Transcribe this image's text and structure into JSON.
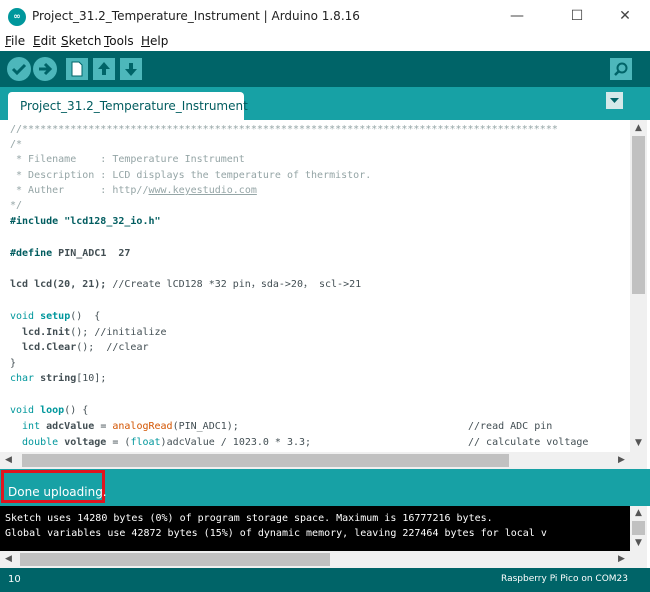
{
  "window": {
    "title": "Project_31.2_Temperature_Instrument | Arduino 1.8.16",
    "minimize": "—",
    "maximize": "☐",
    "close": "✕"
  },
  "menu": [
    {
      "prefix": "",
      "u": "F",
      "rest": "ile"
    },
    {
      "prefix": "",
      "u": "E",
      "rest": "dit"
    },
    {
      "prefix": "",
      "u": "S",
      "rest": "ketch"
    },
    {
      "prefix": "",
      "u": "T",
      "rest": "ools"
    },
    {
      "prefix": "",
      "u": "H",
      "rest": "elp"
    }
  ],
  "toolbar": {
    "verify_icon": "check-icon",
    "upload_icon": "arrow-right-icon",
    "new_icon": "new-file-icon",
    "open_icon": "open-icon",
    "save_icon": "save-icon",
    "serial_monitor_icon": "magnifier-icon"
  },
  "tabs": {
    "active": "Project_31.2_Temperature_Instrument"
  },
  "code": {
    "l1": "//*****************************************************************************************",
    "l2": "/*",
    "l3": " * Filename    : Temperature Instrument",
    "l4": " * Description : LCD displays the temperature of thermistor.",
    "l5a": " * Auther      : http//",
    "l5b": "www.keyestudio.com",
    "l6": "*/",
    "l7a": "#include ",
    "l7b": "\"lcd128_32_io.h\"",
    "l8a": "#define ",
    "l8b": "PIN_ADC1  27",
    "l9a": "lcd lcd(20, 21); ",
    "l9b": "//Create lCD128 *32 pin，sda->20， scl->21",
    "l10a": "void ",
    "l10b": "setup",
    "l10c": "()  {",
    "l11a": "  lcd.",
    "l11b": "Init",
    "l11c": "(); ",
    "l11d": "//initialize",
    "l12a": "  lcd.",
    "l12b": "Clear",
    "l12c": "();  ",
    "l12d": "//clear",
    "l13": "}",
    "l14a": "char ",
    "l14b": "string",
    "l14c": "[10];",
    "l15a": "void ",
    "l15b": "loop",
    "l15c": "() {",
    "l16a": "  int ",
    "l16b": "adcValue",
    "l16c": " = ",
    "l16d": "analogRead",
    "l16e": "(PIN_ADC1);",
    "l16f": "//read ADC pin",
    "l17a": "  double ",
    "l17b": "voltage",
    "l17c": " = (",
    "l17d": "float",
    "l17e": ")adcValue / 1023.0 * 3.3;",
    "l17f": "// calculate voltage"
  },
  "status": {
    "message": "Done uploading."
  },
  "console": {
    "line1": "Sketch uses 14280 bytes (0%) of program storage space. Maximum is 16777216 bytes.",
    "line2": "Global variables use 42872 bytes (15%) of dynamic memory, leaving 227464 bytes for local v"
  },
  "footer": {
    "line": "10",
    "board": "Raspberry Pi Pico on COM23"
  },
  "colors": {
    "toolbar": "#006468",
    "tabbar": "#17a1a5",
    "status_highlight": "#e0141e"
  }
}
